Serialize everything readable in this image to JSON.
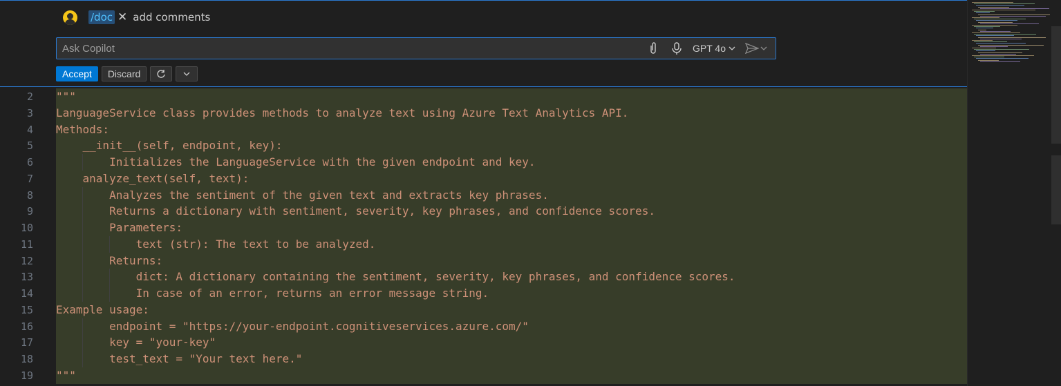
{
  "chat": {
    "command": "/doc",
    "request": "add comments",
    "ask_placeholder": "Ask Copilot",
    "model": "GPT 4o",
    "accept_label": "Accept",
    "discard_label": "Discard"
  },
  "icons": {
    "avatar": "user-avatar",
    "attach": "paperclip-icon",
    "mic": "microphone-icon",
    "send": "send-icon",
    "regenerate": "refresh-icon",
    "more": "chevron-down-icon"
  },
  "colors": {
    "accent": "#0078d4",
    "focus_border": "#2b79d0",
    "string": "#ce9178",
    "diff_added_bg": "#373d29",
    "line_number": "#6e7681"
  },
  "editor": {
    "lines": [
      {
        "num": "2",
        "text": "\"\"\""
      },
      {
        "num": "3",
        "text": "LanguageService class provides methods to analyze text using Azure Text Analytics API."
      },
      {
        "num": "4",
        "text": "Methods:"
      },
      {
        "num": "5",
        "text": "    __init__(self, endpoint, key):"
      },
      {
        "num": "6",
        "text": "        Initializes the LanguageService with the given endpoint and key."
      },
      {
        "num": "7",
        "text": "    analyze_text(self, text):"
      },
      {
        "num": "8",
        "text": "        Analyzes the sentiment of the given text and extracts key phrases."
      },
      {
        "num": "9",
        "text": "        Returns a dictionary with sentiment, severity, key phrases, and confidence scores."
      },
      {
        "num": "10",
        "text": "        Parameters:"
      },
      {
        "num": "11",
        "text": "            text (str): The text to be analyzed."
      },
      {
        "num": "12",
        "text": "        Returns:"
      },
      {
        "num": "13",
        "text": "            dict: A dictionary containing the sentiment, severity, key phrases, and confidence scores."
      },
      {
        "num": "14",
        "text": "            In case of an error, returns an error message string."
      },
      {
        "num": "15",
        "text": "Example usage:"
      },
      {
        "num": "16",
        "text": "        endpoint = \"https://your-endpoint.cognitiveservices.azure.com/\""
      },
      {
        "num": "17",
        "text": "        key = \"your-key\""
      },
      {
        "num": "18",
        "text": "        test_text = \"Your text here.\""
      },
      {
        "num": "19",
        "text": "\"\"\""
      }
    ]
  }
}
